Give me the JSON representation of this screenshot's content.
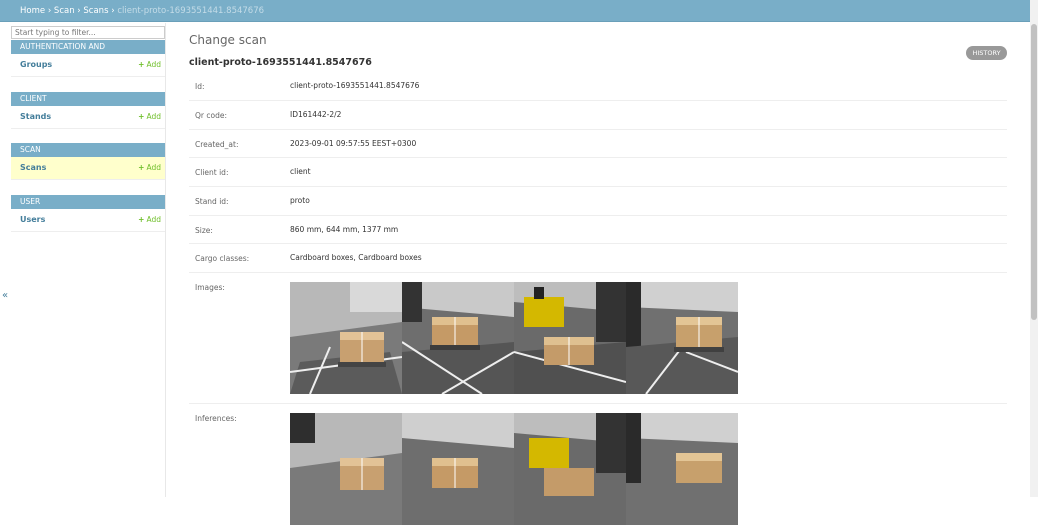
{
  "breadcrumb": {
    "home": "Home",
    "app": "Scan",
    "model": "Scans",
    "current": "client-proto-1693551441.8547676",
    "sep": "›"
  },
  "sidebar": {
    "filter_placeholder": "Start typing to filter...",
    "add_label": "Add",
    "modules": [
      {
        "caption": "AUTHENTICATION AND AUTHORIZATION",
        "model": "Groups"
      },
      {
        "caption": "CLIENT",
        "model": "Stands"
      },
      {
        "caption": "SCAN",
        "model": "Scans"
      },
      {
        "caption": "USER",
        "model": "Users"
      }
    ],
    "collapse_label": "«"
  },
  "main": {
    "page_title": "Change scan",
    "object_title": "client-proto-1693551441.8547676",
    "history_label": "HISTORY",
    "fields": [
      {
        "label": "Id:",
        "value": "client-proto-1693551441.8547676"
      },
      {
        "label": "Qr code:",
        "value": "ID161442-2/2"
      },
      {
        "label": "Created_at:",
        "value": "2023-09-01 09:57:55 EEST+0300"
      },
      {
        "label": "Client id:",
        "value": "client"
      },
      {
        "label": "Stand id:",
        "value": "proto"
      },
      {
        "label": "Size:",
        "value": "860 mm, 644 mm, 1377 mm"
      },
      {
        "label": "Cargo classes:",
        "value": "Cardboard boxes, Cardboard boxes"
      }
    ],
    "images_label": "Images:",
    "inferences_label": "Inferences:"
  },
  "colors": {
    "header": "#79aec8",
    "link": "#447e9b",
    "add": "#70bf2b",
    "active_row": "#ffffcc"
  }
}
